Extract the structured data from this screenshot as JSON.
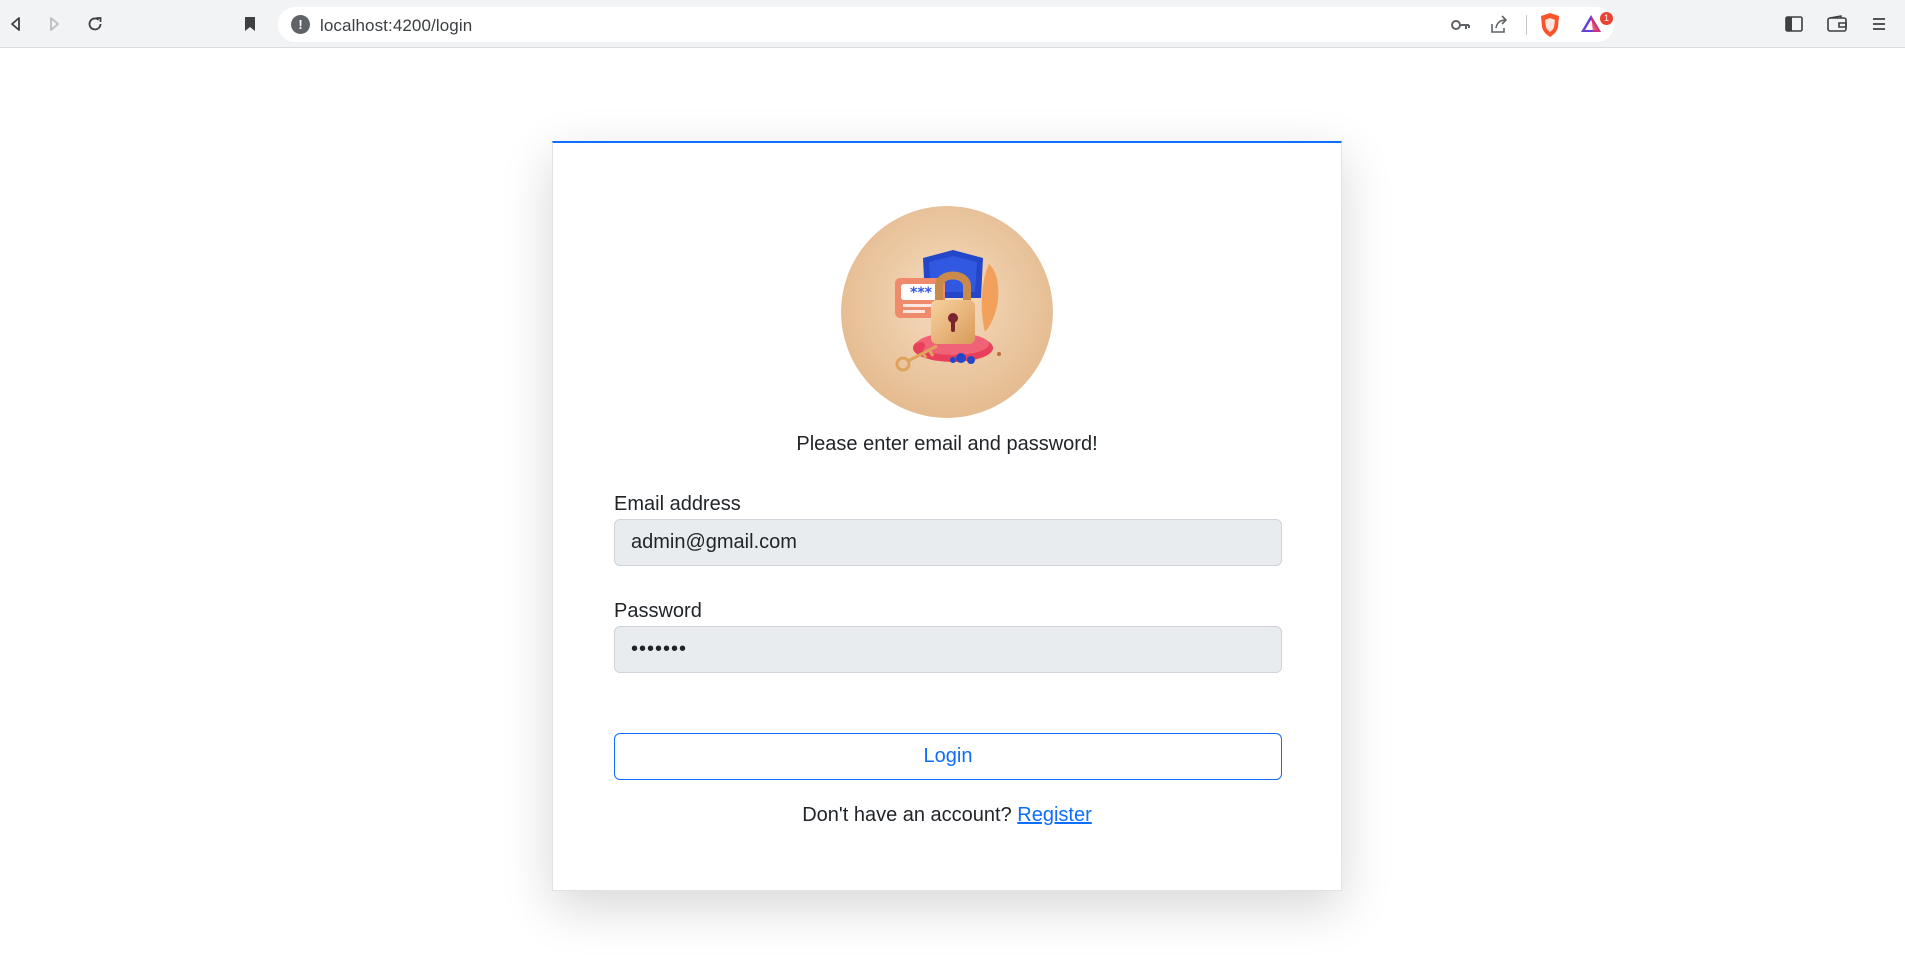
{
  "browser": {
    "url_text": "localhost:4200/login",
    "extension_badge_count": "1"
  },
  "login": {
    "subtitle": "Please enter email and password!",
    "email_label": "Email address",
    "email_value": "admin@gmail.com",
    "password_label": "Password",
    "password_value": "•••••••",
    "login_button": "Login",
    "register_prompt": "Don't have an account?",
    "register_link": "Register"
  },
  "colors": {
    "accent": "#0d6efd",
    "input_bg": "#e9ecef",
    "avatar_bg": "#e7c197"
  },
  "icons": [
    "back-icon",
    "forward-icon",
    "reload-icon",
    "bookmark-icon",
    "site-info-icon",
    "key-icon",
    "share-icon",
    "brave-shield-icon",
    "brave-rewards-icon",
    "sidebar-icon",
    "wallet-icon",
    "menu-icon"
  ]
}
